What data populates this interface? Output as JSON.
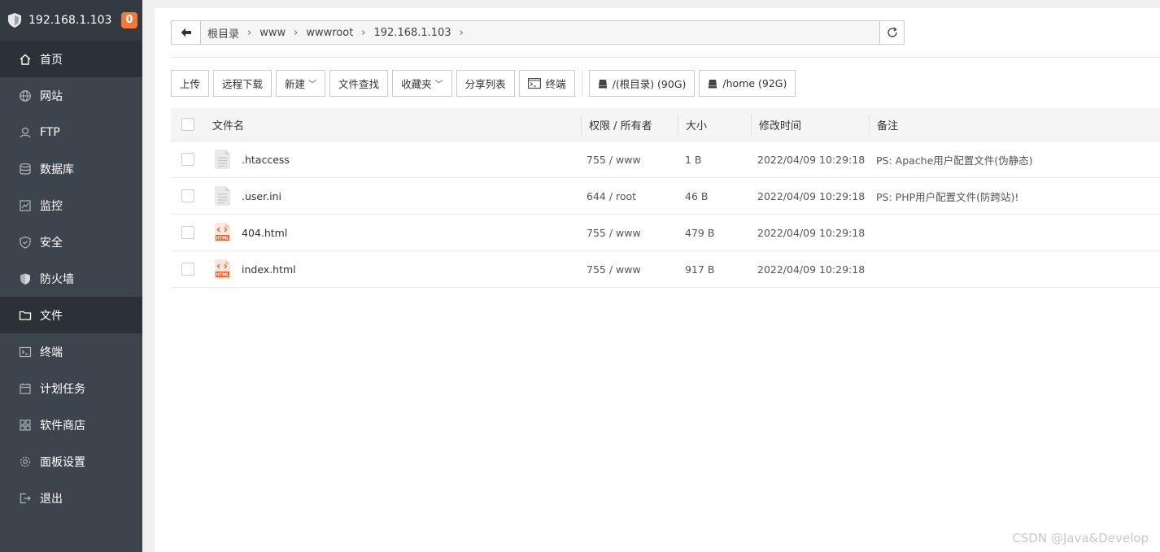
{
  "app": {
    "host": "192.168.1.103",
    "badge": "0"
  },
  "sidebar": {
    "items": [
      {
        "label": "首页",
        "icon": "home-icon"
      },
      {
        "label": "网站",
        "icon": "globe-icon"
      },
      {
        "label": "FTP",
        "icon": "ftp-icon"
      },
      {
        "label": "数据库",
        "icon": "database-icon"
      },
      {
        "label": "监控",
        "icon": "monitor-icon"
      },
      {
        "label": "安全",
        "icon": "shield-icon"
      },
      {
        "label": "防火墙",
        "icon": "firewall-icon"
      },
      {
        "label": "文件",
        "icon": "folder-icon"
      },
      {
        "label": "终端",
        "icon": "terminal-icon"
      },
      {
        "label": "计划任务",
        "icon": "calendar-icon"
      },
      {
        "label": "软件商店",
        "icon": "apps-icon"
      },
      {
        "label": "面板设置",
        "icon": "gear-icon"
      },
      {
        "label": "退出",
        "icon": "logout-icon"
      }
    ]
  },
  "path": {
    "crumbs": [
      "根目录",
      "www",
      "wwwroot",
      "192.168.1.103"
    ]
  },
  "toolbar": {
    "upload": "上传",
    "remote_download": "远程下载",
    "new": "新建",
    "find": "文件查找",
    "favorites": "收藏夹",
    "share_list": "分享列表",
    "terminal": "终端",
    "disk_root": "/(根目录) (90G)",
    "disk_home": "/home (92G)"
  },
  "table": {
    "headers": {
      "name": "文件名",
      "perm": "权限 / 所有者",
      "size": "大小",
      "mtime": "修改时间",
      "remark": "备注"
    },
    "rows": [
      {
        "name": ".htaccess",
        "type": "text-file-icon",
        "perm": "755 / www",
        "size": "1 B",
        "mtime": "2022/04/09 10:29:18",
        "remark": "PS: Apache用户配置文件(伪静态)"
      },
      {
        "name": ".user.ini",
        "type": "text-file-icon",
        "perm": "644 / root",
        "size": "46 B",
        "mtime": "2022/04/09 10:29:18",
        "remark": "PS: PHP用户配置文件(防跨站)!"
      },
      {
        "name": "404.html",
        "type": "html-file-icon",
        "perm": "755 / www",
        "size": "479 B",
        "mtime": "2022/04/09 10:29:18",
        "remark": ""
      },
      {
        "name": "index.html",
        "type": "html-file-icon",
        "perm": "755 / www",
        "size": "917 B",
        "mtime": "2022/04/09 10:29:18",
        "remark": ""
      }
    ]
  },
  "watermark": "CSDN @Java&Develop",
  "colors": {
    "sidebar": "#3c444d",
    "sidebar_active": "#2c3138",
    "badge": "#f0793c",
    "html_icon": "#e8632b"
  }
}
